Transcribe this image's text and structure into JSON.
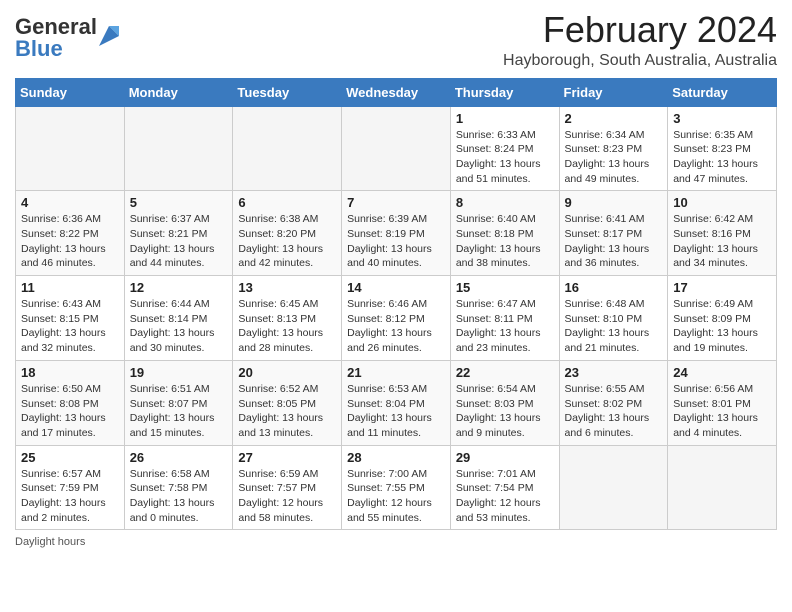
{
  "header": {
    "logo_general": "General",
    "logo_blue": "Blue",
    "title": "February 2024",
    "subtitle": "Hayborough, South Australia, Australia"
  },
  "weekdays": [
    "Sunday",
    "Monday",
    "Tuesday",
    "Wednesday",
    "Thursday",
    "Friday",
    "Saturday"
  ],
  "weeks": [
    [
      {
        "day": "",
        "info": ""
      },
      {
        "day": "",
        "info": ""
      },
      {
        "day": "",
        "info": ""
      },
      {
        "day": "",
        "info": ""
      },
      {
        "day": "1",
        "info": "Sunrise: 6:33 AM\nSunset: 8:24 PM\nDaylight: 13 hours and 51 minutes."
      },
      {
        "day": "2",
        "info": "Sunrise: 6:34 AM\nSunset: 8:23 PM\nDaylight: 13 hours and 49 minutes."
      },
      {
        "day": "3",
        "info": "Sunrise: 6:35 AM\nSunset: 8:23 PM\nDaylight: 13 hours and 47 minutes."
      }
    ],
    [
      {
        "day": "4",
        "info": "Sunrise: 6:36 AM\nSunset: 8:22 PM\nDaylight: 13 hours and 46 minutes."
      },
      {
        "day": "5",
        "info": "Sunrise: 6:37 AM\nSunset: 8:21 PM\nDaylight: 13 hours and 44 minutes."
      },
      {
        "day": "6",
        "info": "Sunrise: 6:38 AM\nSunset: 8:20 PM\nDaylight: 13 hours and 42 minutes."
      },
      {
        "day": "7",
        "info": "Sunrise: 6:39 AM\nSunset: 8:19 PM\nDaylight: 13 hours and 40 minutes."
      },
      {
        "day": "8",
        "info": "Sunrise: 6:40 AM\nSunset: 8:18 PM\nDaylight: 13 hours and 38 minutes."
      },
      {
        "day": "9",
        "info": "Sunrise: 6:41 AM\nSunset: 8:17 PM\nDaylight: 13 hours and 36 minutes."
      },
      {
        "day": "10",
        "info": "Sunrise: 6:42 AM\nSunset: 8:16 PM\nDaylight: 13 hours and 34 minutes."
      }
    ],
    [
      {
        "day": "11",
        "info": "Sunrise: 6:43 AM\nSunset: 8:15 PM\nDaylight: 13 hours and 32 minutes."
      },
      {
        "day": "12",
        "info": "Sunrise: 6:44 AM\nSunset: 8:14 PM\nDaylight: 13 hours and 30 minutes."
      },
      {
        "day": "13",
        "info": "Sunrise: 6:45 AM\nSunset: 8:13 PM\nDaylight: 13 hours and 28 minutes."
      },
      {
        "day": "14",
        "info": "Sunrise: 6:46 AM\nSunset: 8:12 PM\nDaylight: 13 hours and 26 minutes."
      },
      {
        "day": "15",
        "info": "Sunrise: 6:47 AM\nSunset: 8:11 PM\nDaylight: 13 hours and 23 minutes."
      },
      {
        "day": "16",
        "info": "Sunrise: 6:48 AM\nSunset: 8:10 PM\nDaylight: 13 hours and 21 minutes."
      },
      {
        "day": "17",
        "info": "Sunrise: 6:49 AM\nSunset: 8:09 PM\nDaylight: 13 hours and 19 minutes."
      }
    ],
    [
      {
        "day": "18",
        "info": "Sunrise: 6:50 AM\nSunset: 8:08 PM\nDaylight: 13 hours and 17 minutes."
      },
      {
        "day": "19",
        "info": "Sunrise: 6:51 AM\nSunset: 8:07 PM\nDaylight: 13 hours and 15 minutes."
      },
      {
        "day": "20",
        "info": "Sunrise: 6:52 AM\nSunset: 8:05 PM\nDaylight: 13 hours and 13 minutes."
      },
      {
        "day": "21",
        "info": "Sunrise: 6:53 AM\nSunset: 8:04 PM\nDaylight: 13 hours and 11 minutes."
      },
      {
        "day": "22",
        "info": "Sunrise: 6:54 AM\nSunset: 8:03 PM\nDaylight: 13 hours and 9 minutes."
      },
      {
        "day": "23",
        "info": "Sunrise: 6:55 AM\nSunset: 8:02 PM\nDaylight: 13 hours and 6 minutes."
      },
      {
        "day": "24",
        "info": "Sunrise: 6:56 AM\nSunset: 8:01 PM\nDaylight: 13 hours and 4 minutes."
      }
    ],
    [
      {
        "day": "25",
        "info": "Sunrise: 6:57 AM\nSunset: 7:59 PM\nDaylight: 13 hours and 2 minutes."
      },
      {
        "day": "26",
        "info": "Sunrise: 6:58 AM\nSunset: 7:58 PM\nDaylight: 13 hours and 0 minutes."
      },
      {
        "day": "27",
        "info": "Sunrise: 6:59 AM\nSunset: 7:57 PM\nDaylight: 12 hours and 58 minutes."
      },
      {
        "day": "28",
        "info": "Sunrise: 7:00 AM\nSunset: 7:55 PM\nDaylight: 12 hours and 55 minutes."
      },
      {
        "day": "29",
        "info": "Sunrise: 7:01 AM\nSunset: 7:54 PM\nDaylight: 12 hours and 53 minutes."
      },
      {
        "day": "",
        "info": ""
      },
      {
        "day": "",
        "info": ""
      }
    ]
  ],
  "footer": {
    "note": "Daylight hours"
  }
}
